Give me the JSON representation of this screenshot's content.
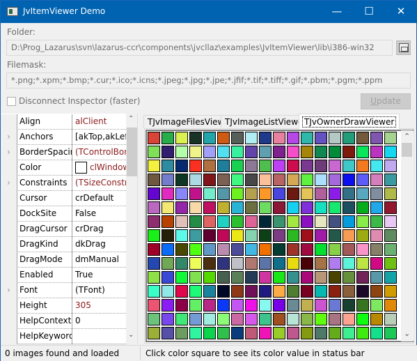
{
  "window": {
    "title": "JvItemViewer Demo",
    "minimize": "—",
    "maximize": "☐",
    "close": "✕",
    "accent": "#0063b1"
  },
  "folder": {
    "label": "Folder:",
    "value": "D:\\Prog_Lazarus\\svn\\lazarus-ccr\\components\\jvcllaz\\examples\\JvItemViewer\\lib\\i386-win32",
    "browse_icon": "folder-browse-icon"
  },
  "filemask": {
    "label": "Filemask:",
    "value": "*.png;*.xpm;*.bmp;*.cur;*.ico;*.icns;*.jpeg;*.jpg;*.jpe;*.jfif;*.tif;*.tiff;*.gif;*.pbm;*.pgm;*.ppm"
  },
  "disconnect": {
    "label": "Disconnect Inspector (faster)",
    "checked": false
  },
  "update_button": {
    "label_u": "U",
    "label_rest": "pdate",
    "enabled": false
  },
  "inspector": {
    "rows": [
      {
        "name": "Align",
        "value": "alClient",
        "expandable": false,
        "modified": true
      },
      {
        "name": "Anchors",
        "value": "[akTop,akLeft,",
        "expandable": true,
        "modified": false
      },
      {
        "name": "BorderSpacing",
        "value": "(TControlBord",
        "expandable": true,
        "modified": true
      },
      {
        "name": "Color",
        "value": "clWindow",
        "expandable": false,
        "modified": true,
        "swatch": "#ffffff"
      },
      {
        "name": "Constraints",
        "value": "(TSizeConstrai",
        "expandable": true,
        "modified": true
      },
      {
        "name": "Cursor",
        "value": "crDefault",
        "expandable": false,
        "modified": false
      },
      {
        "name": "DockSite",
        "value": "False",
        "expandable": false,
        "modified": false
      },
      {
        "name": "DragCursor",
        "value": "crDrag",
        "expandable": false,
        "modified": false
      },
      {
        "name": "DragKind",
        "value": "dkDrag",
        "expandable": false,
        "modified": false
      },
      {
        "name": "DragMode",
        "value": "dmManual",
        "expandable": false,
        "modified": false
      },
      {
        "name": "Enabled",
        "value": "True",
        "expandable": false,
        "modified": false
      },
      {
        "name": "Font",
        "value": "(TFont)",
        "expandable": true,
        "modified": false
      },
      {
        "name": "Height",
        "value": "305",
        "expandable": false,
        "modified": true
      },
      {
        "name": "HelpContext",
        "value": "0",
        "expandable": false,
        "modified": false
      },
      {
        "name": "HelpKeyword",
        "value": "",
        "expandable": false,
        "modified": false
      }
    ]
  },
  "tabs": [
    {
      "label": "TJvImageFilesView"
    },
    {
      "label": "TJvImageListViewer"
    },
    {
      "label": "TJvOwnerDrawViewer",
      "active": true
    }
  ],
  "color_grid": [
    [
      "#d94438",
      "#27ae4a",
      "#dbf152",
      "#183226",
      "#22a5ab",
      "#cf5a12",
      "#566058",
      "#b0eef4",
      "#1f3a8a",
      "#e880a0",
      "#b548e6",
      "#2fb8aa",
      "#6352c0",
      "#b4c8c4",
      "#229d7a",
      "#735a3c",
      "#8057ae",
      "#a4d490"
    ],
    [
      "#80e05a",
      "#311e6e",
      "#b4ffaa",
      "#eef48a",
      "#a0a0f8",
      "#52e0f0",
      "#38f0a0",
      "#6244aa",
      "#5fa0b0",
      "#7e2290",
      "#f64ec8",
      "#a6860a",
      "#118850",
      "#008a3a",
      "#7c1a0e",
      "#0ae65a",
      "#ba34c0",
      "#14d8f0"
    ],
    [
      "#f4f040",
      "#2e8ca0",
      "#052a70",
      "#fc3020",
      "#b07040",
      "#1e7e9c",
      "#1ad050",
      "#8e7898",
      "#4fbe4e",
      "#bd40f4",
      "#cc0e50",
      "#7a3890",
      "#703c78",
      "#c868d0",
      "#3ec8c8",
      "#f47a20",
      "#46e8f0",
      "#c0aaf0"
    ],
    [
      "#6e5840",
      "#727ecc",
      "#0e3624",
      "#acd8e4",
      "#80161a",
      "#7c6054",
      "#40f880",
      "#484848",
      "#fac09a",
      "#b86464",
      "#d4a855",
      "#60f040",
      "#aae0fc",
      "#a46adc",
      "#0c10f0",
      "#5c5cf8",
      "#d47ebc",
      "#3a9aa0"
    ],
    [
      "#6406d0",
      "#e02ac0",
      "#8886f8",
      "#c0128a",
      "#74eccc",
      "#5498a8",
      "#6cf020",
      "#b4a04e",
      "#fc9828",
      "#4a44e0",
      "#6c1a10",
      "#e2c458",
      "#b0609a",
      "#8c1ce8",
      "#347088",
      "#58a8c0",
      "#808ea0",
      "#b0ba48"
    ],
    [
      "#ba68c0",
      "#f4e874",
      "#9426a8",
      "#f8daa8",
      "#c01060",
      "#c0b030",
      "#2ab4d4",
      "#6c7040",
      "#6edc60",
      "#8c1838",
      "#16d0f0",
      "#8030d8",
      "#16e0c0",
      "#16e870",
      "#1c5060",
      "#06ac1c",
      "#20a8e8",
      "#92182e"
    ],
    [
      "#8e2e6e",
      "#b84000",
      "#e0c0b8",
      "#248c44",
      "#de6464",
      "#20d0c0",
      "#2cc030",
      "#de6498",
      "#022838",
      "#3a9470",
      "#a2e840",
      "#8a10c0",
      "#e6e6c0",
      "#445080",
      "#049cdc",
      "#88ec48",
      "#3cb848",
      "#e8c8f4"
    ],
    [
      "#18f018",
      "#242008",
      "#5cf8e8",
      "#3d9ca0",
      "#600030",
      "#c00858",
      "#ece818",
      "#84d4b0",
      "#0e4018",
      "#7c3c84",
      "#2cb820",
      "#a0101a",
      "#a01ca8",
      "#24584a",
      "#f89c54",
      "#9cac10",
      "#e08cb0",
      "#5e8c60"
    ],
    [
      "#a00028",
      "#0a6cf8",
      "#484800",
      "#50ff10",
      "#6098c8",
      "#ba8cb0",
      "#4c4c98",
      "#42b8e4",
      "#f07000",
      "#033c30",
      "#9e3428",
      "#a00a40",
      "#04e030",
      "#88d048",
      "#a45858",
      "#fa94c8",
      "#868068",
      "#6ab070"
    ],
    [
      "#2448b0",
      "#70a858",
      "#328868",
      "#ecfc58",
      "#4a3010",
      "#30347e",
      "#c0c0c8",
      "#b07870",
      "#5c74a8",
      "#10708c",
      "#e8dc10",
      "#4a0008",
      "#a47448",
      "#b07cf0",
      "#5cf4d8",
      "#bce444",
      "#d20884",
      "#6ec012"
    ],
    [
      "#90e048",
      "#3a48d8",
      "#10f838",
      "#80e050",
      "#54d800",
      "#486050",
      "#5a8058",
      "#243c58",
      "#d034a0",
      "#18e818",
      "#369090",
      "#a80878",
      "#b89678",
      "#484400",
      "#66903c",
      "#702458",
      "#5898a8",
      "#14a4a8"
    ],
    [
      "#3cffc8",
      "#90e8e8",
      "#e0084c",
      "#1cfa78",
      "#1a84a0",
      "#000828",
      "#8e3818",
      "#701058",
      "#201a80",
      "#fcac44",
      "#4f7e30",
      "#780020",
      "#06b8b0",
      "#8a2010",
      "#8a603c",
      "#1c0828",
      "#8c4410",
      "#d09c00"
    ],
    [
      "#ec5474",
      "#8c1cf4",
      "#8c0048",
      "#64f064",
      "#b82888",
      "#0c38f8",
      "#c456f4",
      "#f010e8",
      "#88f8f0",
      "#7800e8",
      "#6a8a94",
      "#c2b050",
      "#cc54d0",
      "#6a7ad4",
      "#184030",
      "#367420",
      "#7ee860",
      "#e08808"
    ],
    [
      "#6cc47c",
      "#7848ee",
      "#40e878",
      "#749cd4",
      "#a0ece0",
      "#8cfc78",
      "#cc68a4",
      "#d858ec",
      "#3cc48c",
      "#a05020",
      "#b8e4d8",
      "#8ab848",
      "#60fc10",
      "#a87484",
      "#fca490",
      "#10fc10",
      "#b88800",
      "#b8ceb8"
    ],
    [
      "#9cb038",
      "#5650a8",
      "#6c9c60",
      "#30f4a0",
      "#0cd44c",
      "#30c04c",
      "#0a3c7c",
      "#c05878",
      "#f014b8",
      "#98cc28",
      "#c05890",
      "#849a10",
      "#4e7868",
      "#64ac1c",
      "#3cf090",
      "#40ec10",
      "#14e08c",
      "#1cc858"
    ]
  ],
  "status": {
    "left": "0 images found and loaded",
    "right": "Click color square to see its color value in status bar"
  }
}
